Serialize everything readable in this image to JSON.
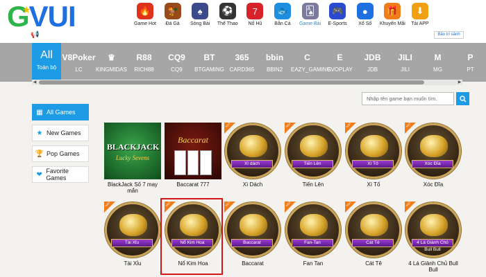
{
  "logo": {
    "text": "GVUI"
  },
  "topnav": [
    {
      "label": "Game Hot",
      "icon": "fire-icon",
      "color": "#e0311a"
    },
    {
      "label": "Đá Gà",
      "icon": "rooster-icon",
      "color": "#9a4a1a"
    },
    {
      "label": "Sòng Bài",
      "icon": "cards-icon",
      "color": "#3a4a8a"
    },
    {
      "label": "Thể Thao",
      "icon": "soccer-ball-icon",
      "color": "#333333"
    },
    {
      "label": "Nổ Hũ",
      "icon": "slot-777-icon",
      "color": "#d8222a"
    },
    {
      "label": "Bắn Cá",
      "icon": "fish-icon",
      "color": "#1e8fe0"
    },
    {
      "label": "Game Bài",
      "icon": "playing-cards-icon",
      "color": "#7a7a9a"
    },
    {
      "label": "E-Sports",
      "icon": "gamepad-icon",
      "color": "#2a4ad0"
    },
    {
      "label": "Xổ Số",
      "icon": "lottery-ball-icon",
      "color": "#1e6fe0"
    },
    {
      "label": "Khuyến Mãi",
      "icon": "gift-icon",
      "color": "#f07c1a"
    },
    {
      "label": "Tải APP",
      "icon": "download-icon",
      "color": "#f0a010"
    }
  ],
  "topnav_active": "Game Bài",
  "maintenance_label": "Bảo trì sảnh",
  "providers": {
    "all": {
      "big": "All",
      "small": "Toàn bộ"
    },
    "items": [
      {
        "logo": "V8Poker",
        "name": "LC"
      },
      {
        "logo": "♛",
        "name": "KINGMIDAS"
      },
      {
        "logo": "R88",
        "name": "RICH88"
      },
      {
        "logo": "CQ9",
        "name": "CQ9"
      },
      {
        "logo": "BT",
        "name": "BTGAMING"
      },
      {
        "logo": "365",
        "name": "CARD365"
      },
      {
        "logo": "bbin",
        "name": "BBIN2"
      },
      {
        "logo": "C",
        "name": "EAZY_GAMING"
      },
      {
        "logo": "E",
        "name": "EVOPLAY"
      },
      {
        "logo": "JDB",
        "name": "JDB"
      },
      {
        "logo": "JILI",
        "name": "JILI"
      },
      {
        "logo": "M",
        "name": "MG"
      },
      {
        "logo": "P",
        "name": "PT"
      }
    ]
  },
  "search": {
    "placeholder": "Nhập tên game bạn muốn tìm."
  },
  "sidebar": [
    {
      "label": "All Games",
      "icon": "grid-icon"
    },
    {
      "label": "New Games",
      "icon": "star-icon"
    },
    {
      "label": "Pop Games",
      "icon": "trophy-icon"
    },
    {
      "label": "Favorite Games",
      "icon": "heart-icon"
    }
  ],
  "games": [
    {
      "title": "BlackJack Số 7 may mắn",
      "ribbon": "",
      "style": "blackjack",
      "hot": false
    },
    {
      "title": "Baccarat 777",
      "ribbon": "",
      "style": "baccarat777",
      "hot": false
    },
    {
      "title": "Xì Dách",
      "ribbon": "Xì dách",
      "style": "circle",
      "hot": true
    },
    {
      "title": "Tiến Lên",
      "ribbon": "Tiến Lên",
      "style": "circle",
      "hot": true
    },
    {
      "title": "Xì Tố",
      "ribbon": "Xì Tố",
      "style": "circle",
      "hot": true
    },
    {
      "title": "Xóc Đĩa",
      "ribbon": "Xóc Đĩa",
      "style": "circle",
      "hot": true
    },
    {
      "title": "Tài Xỉu",
      "ribbon": "Tài Xỉu",
      "style": "circle",
      "hot": true
    },
    {
      "title": "Nổ Kim Hoa",
      "ribbon": "Nổ Kim Hoa",
      "style": "circle",
      "hot": true
    },
    {
      "title": "Baccarat",
      "ribbon": "Baccarat",
      "style": "circle",
      "hot": true
    },
    {
      "title": "Fan Tan",
      "ribbon": "Fan-Tan",
      "style": "circle",
      "hot": true
    },
    {
      "title": "Cát Tê",
      "ribbon": "Cát Tê",
      "style": "circle",
      "hot": true
    },
    {
      "title": "4 Lá Giành Chủ Bull Bull",
      "ribbon": "4 Lá Giành Chủ Bull Bull",
      "style": "circle",
      "hot": true
    }
  ],
  "blackjack_art": {
    "title": "BLACKJACK",
    "subtitle": "Lucky Sevens"
  },
  "baccarat_art": {
    "title": "Baccarat"
  },
  "hot_badge": "HOT"
}
